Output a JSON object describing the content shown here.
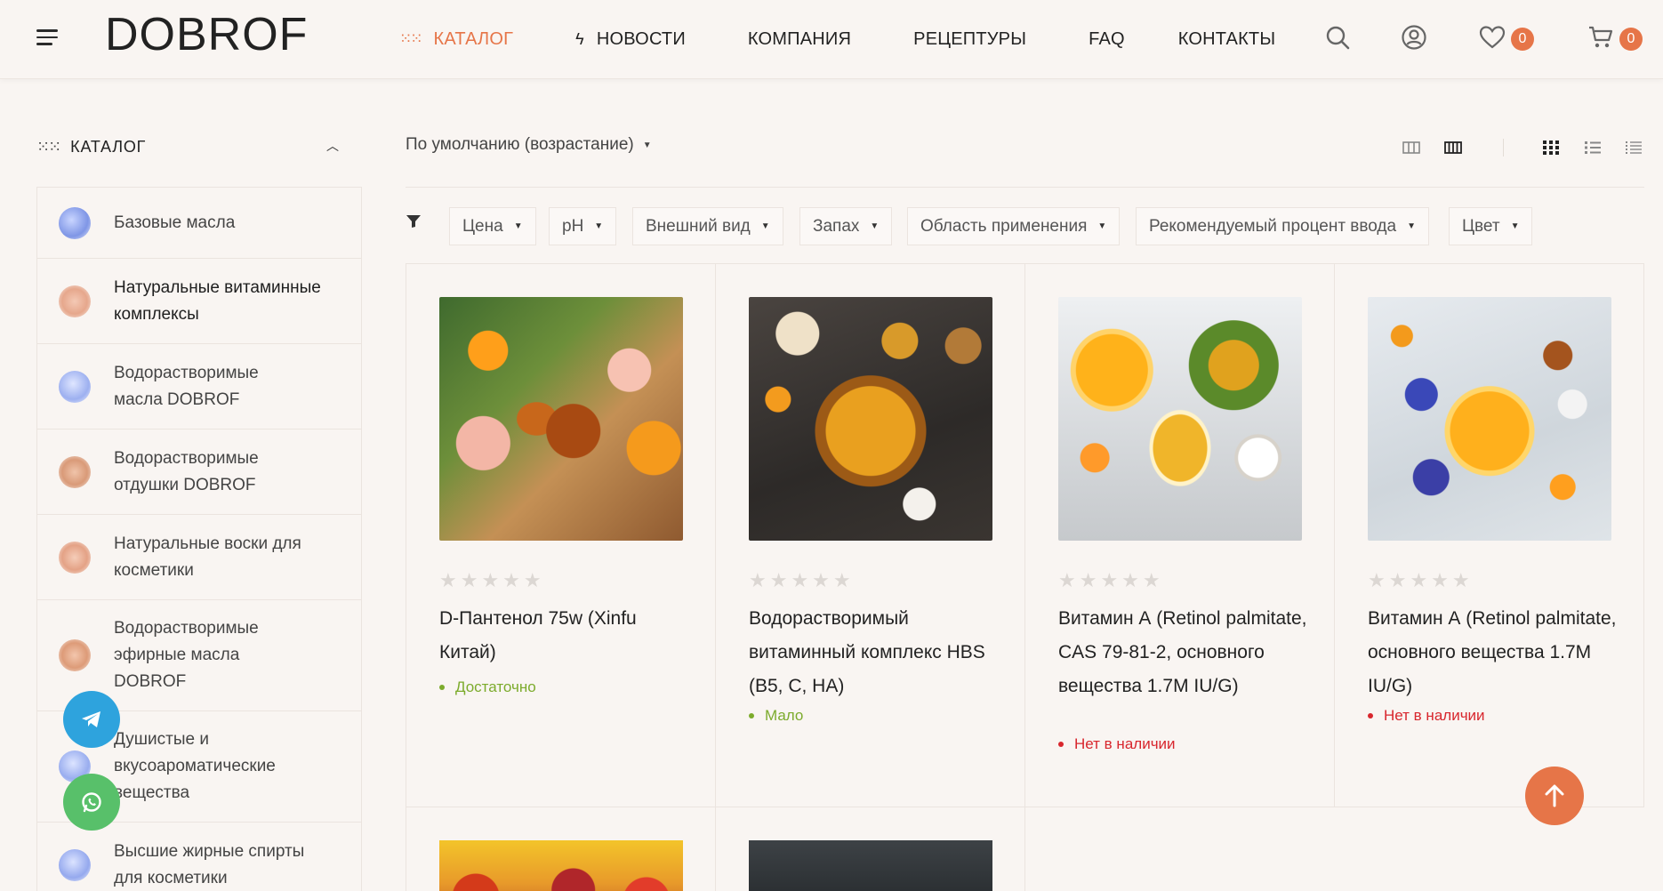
{
  "header": {
    "logo": "DOBROF",
    "nav": [
      {
        "label": "КАТАЛОГ",
        "icon": "catalog-dots-icon"
      },
      {
        "label": "НОВОСТИ",
        "icon": "lightning-icon"
      },
      {
        "label": "КОМПАНИЯ"
      },
      {
        "label": "РЕЦЕПТУРЫ"
      },
      {
        "label": "FAQ"
      },
      {
        "label": "КОНТАКТЫ"
      }
    ],
    "favorites_count": "0",
    "cart_count": "0",
    "accent_color": "#e67548"
  },
  "sidebar": {
    "title": "КАТАЛОГ",
    "items": [
      {
        "label": "Базовые масла"
      },
      {
        "label": "Натуральные витаминные комплексы"
      },
      {
        "label": "Водорастворимые масла DOBROF"
      },
      {
        "label": "Водорастворимые отдушки DOBROF"
      },
      {
        "label": "Натуральные воски для косметики"
      },
      {
        "label": "Водорастворимые эфирные масла DOBROF"
      },
      {
        "label": "Душистые и вкусоароматические вещества"
      },
      {
        "label": "Высшие жирные спирты для косметики"
      }
    ]
  },
  "toolbar": {
    "sort_label": "По умолчанию (возрастание)",
    "filters": [
      "Цена",
      "pH",
      "Внешний вид",
      "Запах",
      "Область применения",
      "Рекомендуемый процент ввода",
      "Цвет"
    ]
  },
  "products": [
    {
      "name": "D-Пантенол 75w (Xinfu Китай)",
      "stock": "Достаточно",
      "stock_color": "#7cab2c"
    },
    {
      "name": "Водорастворимый витаминный комплекс HBS (B5, C, HA)",
      "stock": "Мало",
      "stock_color": "#7cab2c"
    },
    {
      "name": "Витамин А (Retinol palmitate, CAS 79-81-2, основного вещества 1.7М IU/G)",
      "stock": "Нет в наличии",
      "stock_color": "#d8262d"
    },
    {
      "name": "Витамин А (Retinol palmitate, основного вещества 1.7М IU/G)",
      "stock": "Нет в наличии",
      "stock_color": "#d8262d"
    }
  ],
  "floating": {
    "telegram": "telegram-icon",
    "whatsapp": "whatsapp-icon",
    "scroll_top": "arrow-up-icon"
  }
}
